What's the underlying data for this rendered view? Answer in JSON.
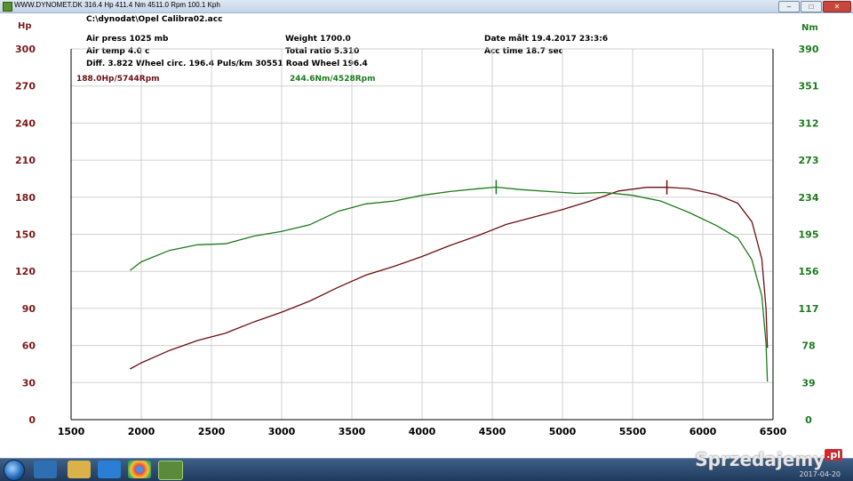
{
  "window": {
    "title": "WWW.DYNOMET.DK  316.4 Hp 411.4 Nm 4511.0 Rpm 100.1 Kph",
    "buttons": [
      "–",
      "□",
      "✕"
    ]
  },
  "header": {
    "file": "C:\\dynodat\\Opel Calibra02.acc",
    "air_press": "Air press  1025 mb",
    "air_temp": "Air temp    4.0 c",
    "diff": "Diff.     3.822   Wheel circ. 196.4   Puls/km   30551  Road Wheel 196.4",
    "weight": "Weight   1700.0",
    "total_ratio": "Total ratio 5.310",
    "date": "Date målt 19.4.2017 23:3:6",
    "acc_time": "Acc time    18.7 sec"
  },
  "chart_data": {
    "type": "line",
    "ylabel_left": "Hp",
    "ylabel_right": "Nm",
    "xlim": [
      1500,
      6500
    ],
    "x_ticks": [
      1500,
      2000,
      2500,
      3000,
      3500,
      4000,
      4500,
      5000,
      5500,
      6000,
      6500
    ],
    "ylim_left": [
      0,
      300
    ],
    "y_ticks_left": [
      0,
      30,
      60,
      90,
      120,
      150,
      180,
      210,
      240,
      270,
      300
    ],
    "ylim_right": [
      0,
      390
    ],
    "y_ticks_right": [
      0,
      39,
      78,
      117,
      156,
      195,
      234,
      273,
      312,
      351,
      390
    ],
    "grid": true,
    "colors": {
      "hp": "#6b0f14",
      "nm": "#1c7a1c",
      "hp_text": "#7a1a1a",
      "nm_text": "#1c7a1c"
    },
    "series": [
      {
        "name": "Hp",
        "axis": "left",
        "peak_label": "188.0Hp/5744Rpm",
        "peak": [
          5744,
          188.0
        ],
        "points": [
          [
            1920,
            41
          ],
          [
            2000,
            46
          ],
          [
            2200,
            56
          ],
          [
            2400,
            64
          ],
          [
            2600,
            70
          ],
          [
            2800,
            79
          ],
          [
            3000,
            87
          ],
          [
            3200,
            96
          ],
          [
            3400,
            107
          ],
          [
            3600,
            117
          ],
          [
            3800,
            124
          ],
          [
            4000,
            132
          ],
          [
            4200,
            141
          ],
          [
            4400,
            149
          ],
          [
            4600,
            158
          ],
          [
            4800,
            164
          ],
          [
            5000,
            170
          ],
          [
            5200,
            177
          ],
          [
            5400,
            185
          ],
          [
            5600,
            188
          ],
          [
            5744,
            188
          ],
          [
            5900,
            187
          ],
          [
            6100,
            182
          ],
          [
            6250,
            175
          ],
          [
            6350,
            160
          ],
          [
            6420,
            130
          ],
          [
            6450,
            90
          ],
          [
            6460,
            58
          ]
        ]
      },
      {
        "name": "Nm",
        "axis": "right",
        "peak_label": "244.6Nm/4528Rpm",
        "peak": [
          4528,
          244.6
        ],
        "points": [
          [
            1920,
            157
          ],
          [
            2000,
            166
          ],
          [
            2200,
            178
          ],
          [
            2400,
            184
          ],
          [
            2600,
            185
          ],
          [
            2800,
            193
          ],
          [
            3000,
            198
          ],
          [
            3200,
            205
          ],
          [
            3400,
            219
          ],
          [
            3600,
            227
          ],
          [
            3800,
            230
          ],
          [
            4000,
            236
          ],
          [
            4200,
            240
          ],
          [
            4400,
            243
          ],
          [
            4528,
            244.6
          ],
          [
            4700,
            242
          ],
          [
            4900,
            240
          ],
          [
            5100,
            238
          ],
          [
            5300,
            239
          ],
          [
            5500,
            236
          ],
          [
            5700,
            230
          ],
          [
            5900,
            218
          ],
          [
            6100,
            204
          ],
          [
            6250,
            191
          ],
          [
            6350,
            168
          ],
          [
            6420,
            130
          ],
          [
            6450,
            80
          ],
          [
            6460,
            40
          ]
        ]
      }
    ]
  },
  "taskbar": {
    "watermark": "Sprzedajemy",
    "watermark_suffix": ".pl",
    "date": "2017-04-20"
  }
}
